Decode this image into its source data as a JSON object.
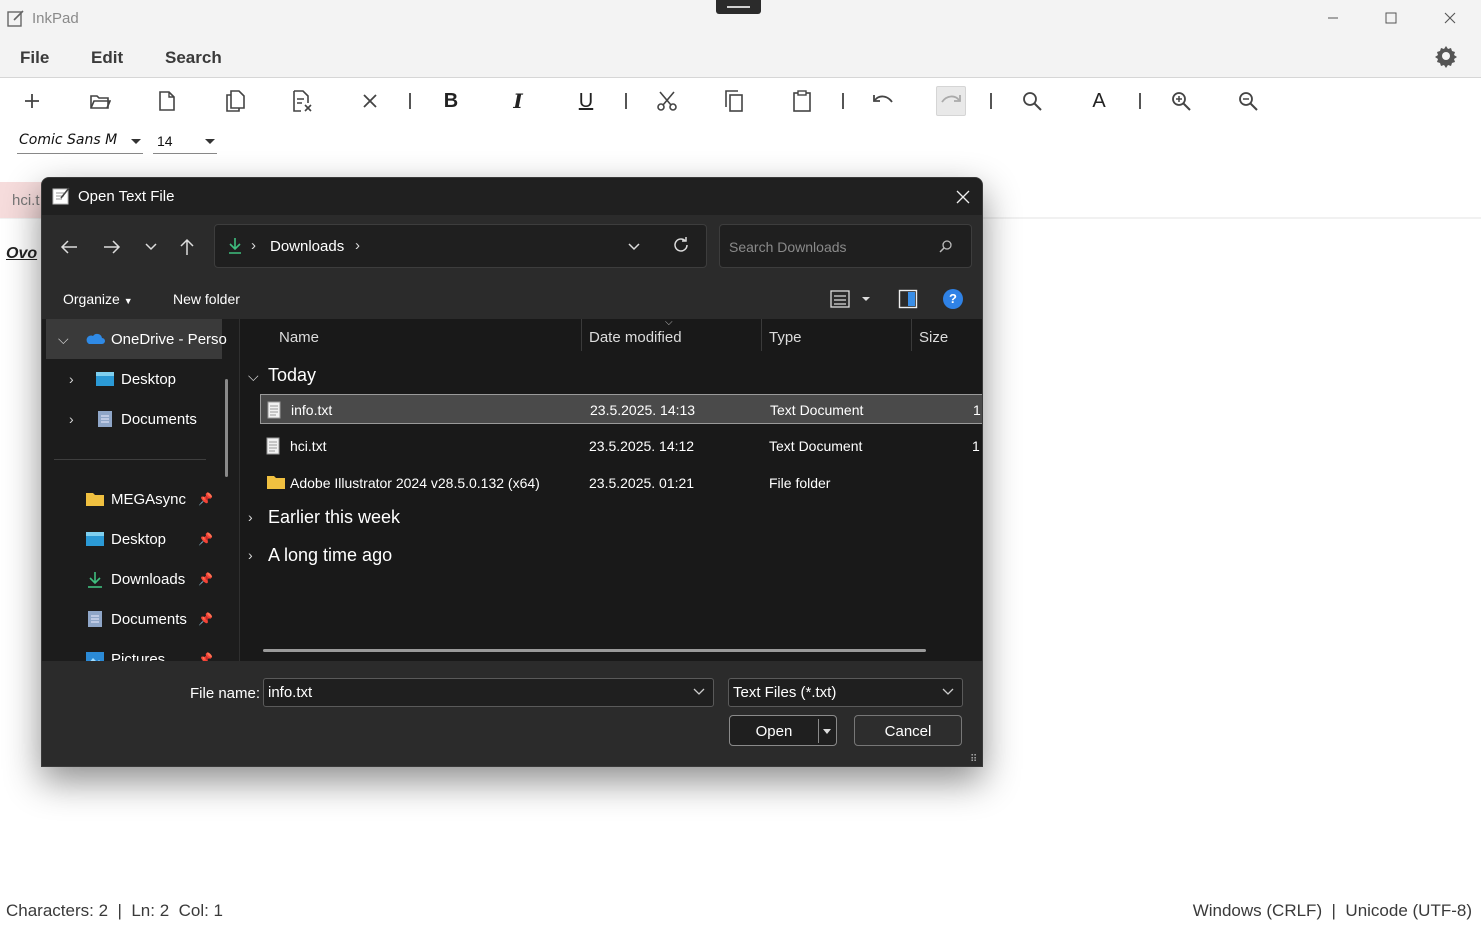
{
  "app": {
    "title": "InkPad",
    "menu": [
      "File",
      "Edit",
      "Search"
    ],
    "font_name": "Comic Sans M",
    "font_size": "14",
    "doc_tab": "hci.t",
    "editor_text": "Ovo",
    "status_left": "Characters: 2  |  Ln: 2  Col: 1",
    "status_right": "Windows (CRLF)  |  Unicode (UTF-8)"
  },
  "toolbar_icons": [
    "plus-icon",
    "folder-open-icon",
    "new-file-icon",
    "copy-file-icon",
    "close-file-icon",
    "close-icon",
    "bold-icon",
    "italic-icon",
    "underline-icon",
    "cut-icon",
    "copy-icon",
    "paste-icon",
    "undo-icon",
    "redo-icon",
    "find-icon",
    "font-icon",
    "zoom-in-icon",
    "zoom-out-icon"
  ],
  "toolbar_letters": {
    "bold": "B",
    "italic": "I",
    "underline": "U",
    "font": "A"
  },
  "dialog": {
    "title": "Open Text File",
    "address": "Downloads",
    "search_placeholder": "Search Downloads",
    "organize": "Organize",
    "new_folder": "New folder",
    "help": "?",
    "nav": [
      {
        "label": "OneDrive - Perso",
        "icon": "onedrive-icon"
      },
      {
        "label": "Desktop",
        "icon": "desktop-folder-icon"
      },
      {
        "label": "Documents",
        "icon": "documents-folder-icon"
      },
      {
        "label": "MEGAsync",
        "icon": "folder-icon"
      },
      {
        "label": "Desktop",
        "icon": "desktop-folder-icon"
      },
      {
        "label": "Downloads",
        "icon": "download-icon"
      },
      {
        "label": "Documents",
        "icon": "documents-folder-icon"
      },
      {
        "label": "Pictures",
        "icon": "pictures-folder-icon"
      }
    ],
    "columns": [
      "Name",
      "Date modified",
      "Type",
      "Size"
    ],
    "groups": [
      "Today",
      "Earlier this week",
      "A long time ago"
    ],
    "files": [
      {
        "name": "info.txt",
        "date": "23.5.2025. 14:13",
        "type": "Text Document",
        "size": "1"
      },
      {
        "name": "hci.txt",
        "date": "23.5.2025. 14:12",
        "type": "Text Document",
        "size": "1"
      },
      {
        "name": "Adobe Illustrator 2024 v28.5.0.132 (x64)",
        "date": "23.5.2025. 01:21",
        "type": "File folder",
        "size": ""
      }
    ],
    "file_name_label": "File name:",
    "file_name_value": "info.txt",
    "filter": "Text Files (*.txt)",
    "open": "Open",
    "cancel": "Cancel"
  },
  "colors": {
    "dialog_bg": "#202020",
    "accent_blue": "#2f82e6",
    "download_green": "#3fbf7f",
    "folder_yellow": "#f0c040"
  }
}
